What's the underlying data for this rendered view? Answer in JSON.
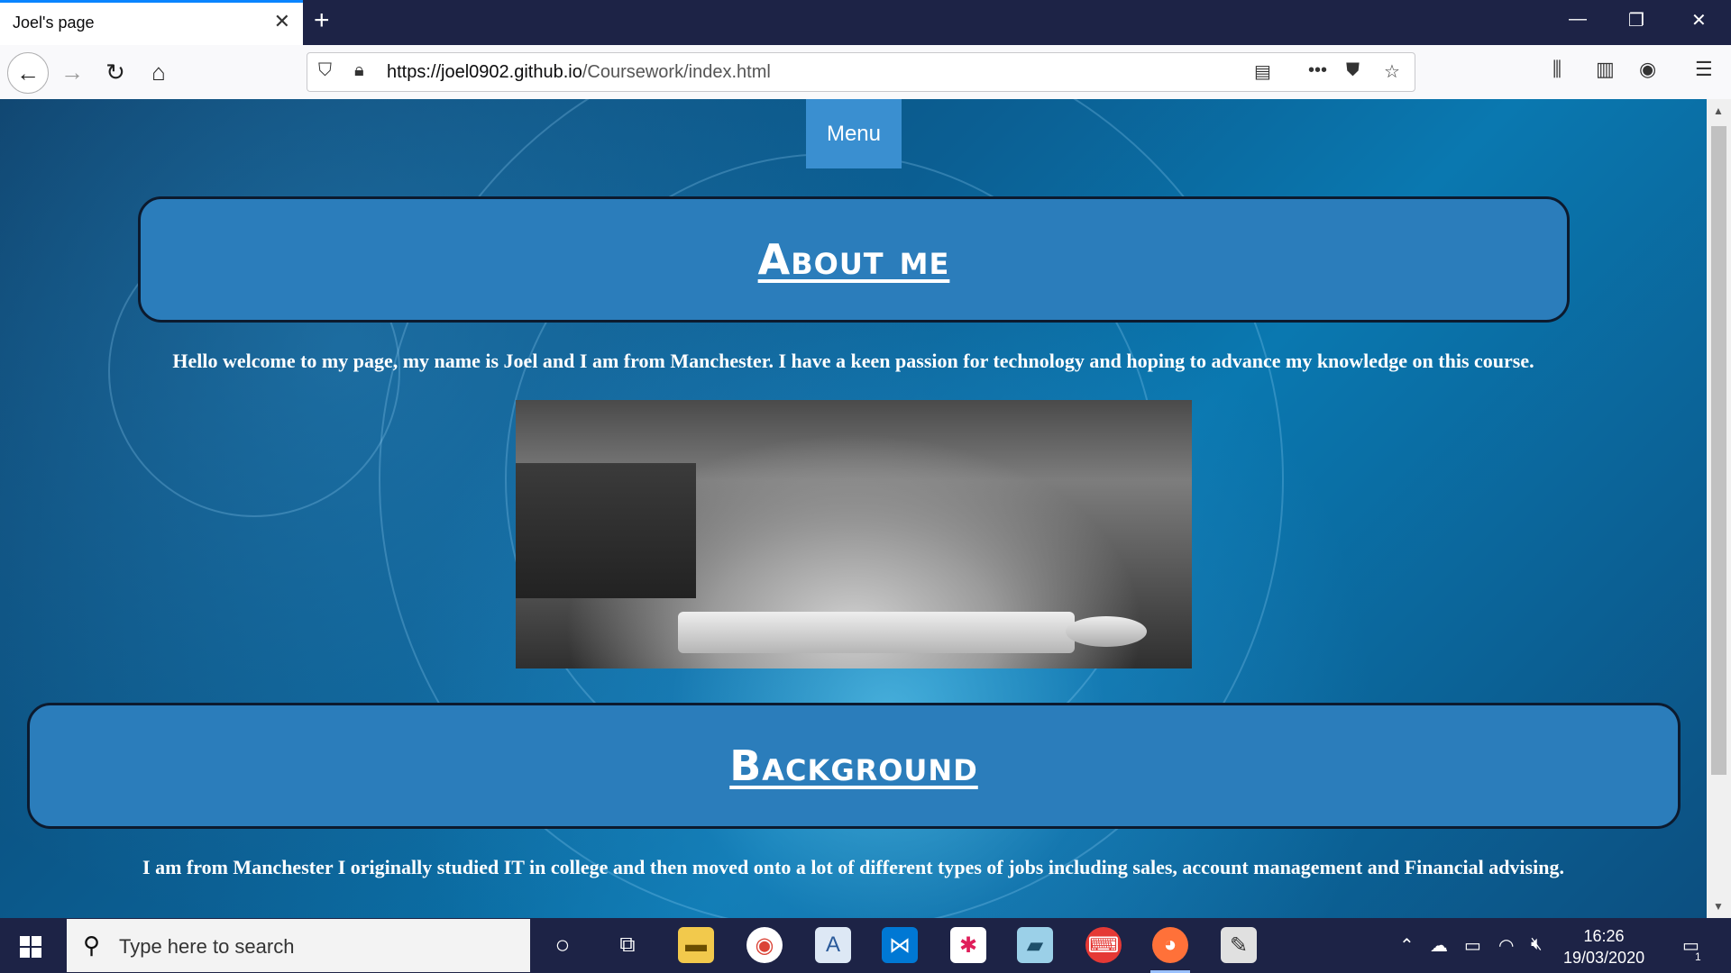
{
  "browser": {
    "tab_title": "Joel's page",
    "url_domain": "https://joel0902.github.io",
    "url_path": "/Coursework/index.html"
  },
  "page": {
    "menu_label": "Menu",
    "about_heading": "About me",
    "about_text": "Hello welcome to my page, my name is Joel and I am from Manchester. I have a keen passion for technology and hoping to advance my knowledge on this course.",
    "background_heading": "Background",
    "background_text": "I am from Manchester I originally studied IT in college and then moved onto a lot of different types of jobs including sales, account management and Financial advising."
  },
  "taskbar": {
    "search_placeholder": "Type here to search",
    "time": "16:26",
    "date": "19/03/2020",
    "notification_count": "1"
  },
  "colors": {
    "accent": "#3a8fd0",
    "heading_box": "#2b7dbb",
    "taskbar": "#1d2346"
  }
}
